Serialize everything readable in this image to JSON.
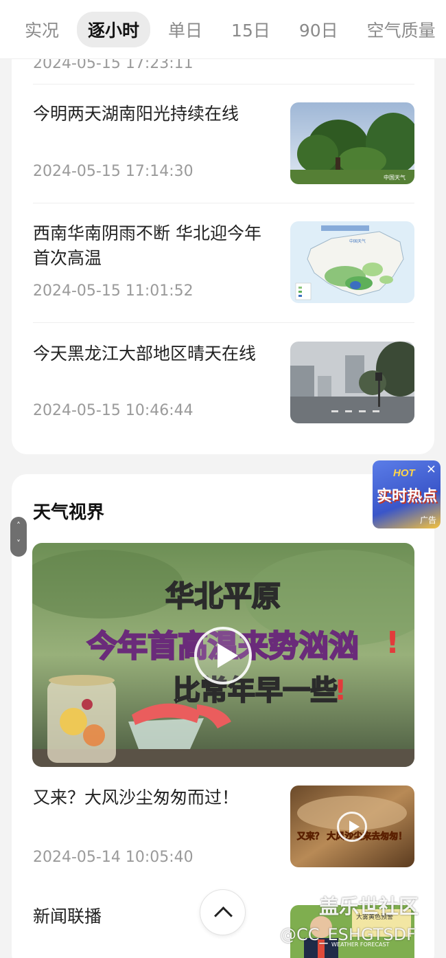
{
  "tabs": [
    {
      "label": "实况",
      "active": false
    },
    {
      "label": "逐小时",
      "active": true
    },
    {
      "label": "单日",
      "active": false
    },
    {
      "label": "15日",
      "active": false
    },
    {
      "label": "90日",
      "active": false
    },
    {
      "label": "空气质量",
      "active": false
    }
  ],
  "news": {
    "clipped_time": "2024-05-15 17:23:11",
    "items": [
      {
        "title": "今明两天湖南阳光持续在线",
        "time": "2024-05-15 17:14:30",
        "thumb_icon": "tree-landscape-photo",
        "thumb_logo": "中国天气"
      },
      {
        "title": "西南华南阴雨不断 华北迎今年首次高温",
        "time": "2024-05-15 11:01:52",
        "thumb_icon": "china-rainfall-map",
        "thumb_logo": "中国天气"
      },
      {
        "title": "今天黑龙江大部地区晴天在线",
        "time": "2024-05-15 10:46:44",
        "thumb_icon": "city-street-photo"
      }
    ]
  },
  "vision": {
    "section_title": "天气视界",
    "main_video": {
      "line1": "华北平原",
      "line2": "今年首高温来势汹汹",
      "line3": "比常年早一些"
    },
    "items": [
      {
        "title": "又来？大风沙尘匆匆而过！",
        "time": "2024-05-14 10:05:40",
        "thumb_text": "又来？ 大风沙尘来去匆匆！"
      },
      {
        "title": "新闻联播",
        "time": "",
        "thumb_text": "大雾黄色预警",
        "thumb_sub": "WEATHER FORECAST"
      }
    ]
  },
  "ad": {
    "hot": "HOT",
    "text": "实时热点",
    "badge": "广告",
    "close": "×"
  },
  "watermark": {
    "line1": "盖乐世社区",
    "line2": "@CC_ESHGTSDF"
  },
  "colors": {
    "background": "#f3f3f3",
    "card": "#ffffff",
    "active_tab_bg": "#ebebeb",
    "muted_text": "#9a9a9a"
  }
}
